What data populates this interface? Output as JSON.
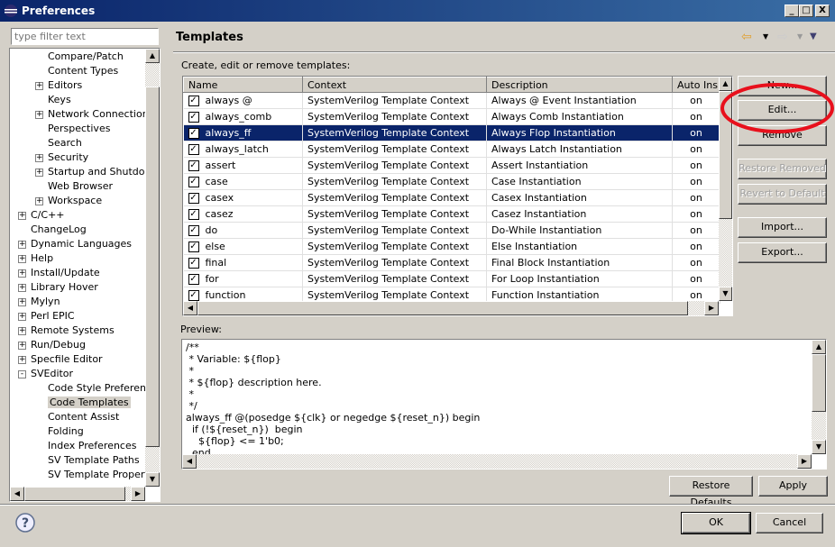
{
  "window": {
    "title": "Preferences",
    "controls": [
      "_",
      "□",
      "X"
    ]
  },
  "filter": {
    "placeholder": "type filter text"
  },
  "tree": [
    {
      "label": "Compare/Patch",
      "level": 1,
      "exp": ""
    },
    {
      "label": "Content Types",
      "level": 1,
      "exp": ""
    },
    {
      "label": "Editors",
      "level": 1,
      "exp": "+"
    },
    {
      "label": "Keys",
      "level": 1,
      "exp": ""
    },
    {
      "label": "Network Connections",
      "level": 1,
      "exp": "+"
    },
    {
      "label": "Perspectives",
      "level": 1,
      "exp": ""
    },
    {
      "label": "Search",
      "level": 1,
      "exp": ""
    },
    {
      "label": "Security",
      "level": 1,
      "exp": "+"
    },
    {
      "label": "Startup and Shutdown",
      "level": 1,
      "exp": "+"
    },
    {
      "label": "Web Browser",
      "level": 1,
      "exp": ""
    },
    {
      "label": "Workspace",
      "level": 1,
      "exp": "+"
    },
    {
      "label": "C/C++",
      "level": 0,
      "exp": "+"
    },
    {
      "label": "ChangeLog",
      "level": 0,
      "exp": ""
    },
    {
      "label": "Dynamic Languages",
      "level": 0,
      "exp": "+"
    },
    {
      "label": "Help",
      "level": 0,
      "exp": "+"
    },
    {
      "label": "Install/Update",
      "level": 0,
      "exp": "+"
    },
    {
      "label": "Library Hover",
      "level": 0,
      "exp": "+"
    },
    {
      "label": "Mylyn",
      "level": 0,
      "exp": "+"
    },
    {
      "label": "Perl EPIC",
      "level": 0,
      "exp": "+"
    },
    {
      "label": "Remote Systems",
      "level": 0,
      "exp": "+"
    },
    {
      "label": "Run/Debug",
      "level": 0,
      "exp": "+"
    },
    {
      "label": "Specfile Editor",
      "level": 0,
      "exp": "+"
    },
    {
      "label": "SVEditor",
      "level": 0,
      "exp": "-"
    },
    {
      "label": "Code Style Preference",
      "level": 1,
      "exp": ""
    },
    {
      "label": "Code Templates",
      "level": 1,
      "exp": "",
      "selected": true
    },
    {
      "label": "Content Assist",
      "level": 1,
      "exp": ""
    },
    {
      "label": "Folding",
      "level": 1,
      "exp": ""
    },
    {
      "label": "Index Preferences",
      "level": 1,
      "exp": ""
    },
    {
      "label": "SV Template Paths",
      "level": 1,
      "exp": ""
    },
    {
      "label": "SV Template Properties",
      "level": 1,
      "exp": ""
    }
  ],
  "page": {
    "title": "Templates",
    "subtitle": "Create, edit or remove templates:",
    "preview_label": "Preview:"
  },
  "table": {
    "columns": [
      "Name",
      "Context",
      "Description",
      "Auto Ins."
    ],
    "rows": [
      {
        "name": "always @",
        "context": "SystemVerilog Template Context",
        "description": "Always @ Event Instantiation",
        "auto": "on",
        "checked": true
      },
      {
        "name": "always_comb",
        "context": "SystemVerilog Template Context",
        "description": "Always Comb Instantiation",
        "auto": "on",
        "checked": true
      },
      {
        "name": "always_ff",
        "context": "SystemVerilog Template Context",
        "description": "Always Flop Instantiation",
        "auto": "on",
        "checked": true,
        "selected": true
      },
      {
        "name": "always_latch",
        "context": "SystemVerilog Template Context",
        "description": "Always Latch Instantiation",
        "auto": "on",
        "checked": true
      },
      {
        "name": "assert",
        "context": "SystemVerilog Template Context",
        "description": "Assert Instantiation",
        "auto": "on",
        "checked": true
      },
      {
        "name": "case",
        "context": "SystemVerilog Template Context",
        "description": "Case Instantiation",
        "auto": "on",
        "checked": true
      },
      {
        "name": "casex",
        "context": "SystemVerilog Template Context",
        "description": "Casex Instantiation",
        "auto": "on",
        "checked": true
      },
      {
        "name": "casez",
        "context": "SystemVerilog Template Context",
        "description": "Casez Instantiation",
        "auto": "on",
        "checked": true
      },
      {
        "name": "do",
        "context": "SystemVerilog Template Context",
        "description": "Do-While Instantiation",
        "auto": "on",
        "checked": true
      },
      {
        "name": "else",
        "context": "SystemVerilog Template Context",
        "description": "Else Instantiation",
        "auto": "on",
        "checked": true
      },
      {
        "name": "final",
        "context": "SystemVerilog Template Context",
        "description": "Final Block Instantiation",
        "auto": "on",
        "checked": true
      },
      {
        "name": "for",
        "context": "SystemVerilog Template Context",
        "description": "For Loop Instantiation",
        "auto": "on",
        "checked": true
      },
      {
        "name": "function",
        "context": "SystemVerilog Template Context",
        "description": "Function Instantiation",
        "auto": "on",
        "checked": true
      }
    ]
  },
  "side_buttons": [
    {
      "label": "New...",
      "enabled": true
    },
    {
      "label": "Edit...",
      "enabled": true
    },
    {
      "label": "Remove",
      "enabled": true
    },
    {
      "label": "Restore Removed",
      "enabled": false
    },
    {
      "label": "Revert to Default",
      "enabled": false
    },
    {
      "label": "Import...",
      "enabled": true
    },
    {
      "label": "Export...",
      "enabled": true
    }
  ],
  "preview": [
    "/**",
    " * Variable: ${flop}",
    " *",
    " * ${flop} description here.",
    " *",
    " */",
    "always_ff @(posedge ${clk} or negedge ${reset_n}) begin",
    "  if (!${reset_n})  begin",
    "    ${flop} <= 1'b0;",
    "  end"
  ],
  "buttons": {
    "restore_defaults": "Restore Defaults",
    "apply": "Apply",
    "ok": "OK",
    "cancel": "Cancel"
  },
  "colors": {
    "selection": "#0a246a",
    "highlight_ellipse": "#e8101c",
    "title_bar": "#0a246a"
  }
}
